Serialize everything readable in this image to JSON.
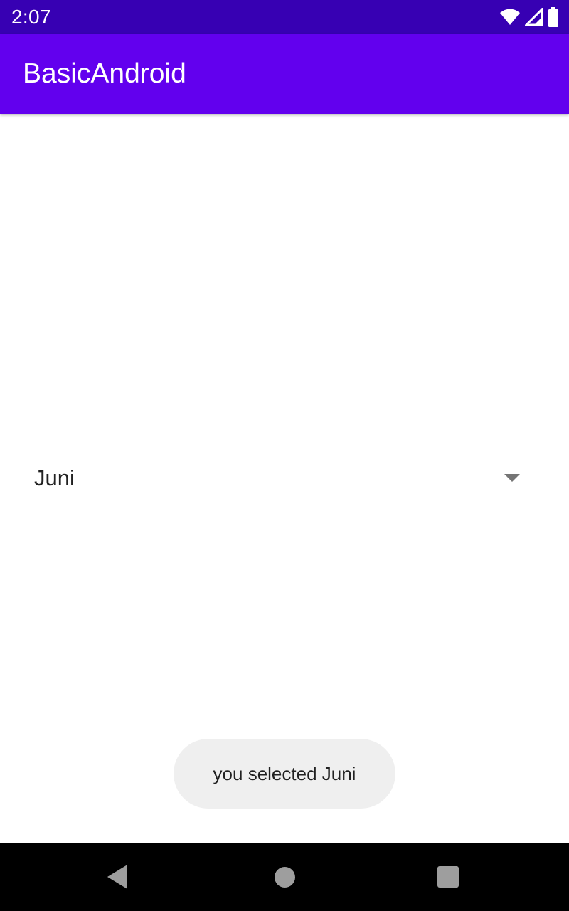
{
  "status_bar": {
    "time": "2:07",
    "icons": [
      "wifi-icon",
      "cellular-signal-icon",
      "battery-icon"
    ],
    "color": "#3700B3"
  },
  "app_bar": {
    "title": "BasicAndroid",
    "color": "#6200EE"
  },
  "spinner": {
    "selected": "Juni",
    "arrow_icon": "dropdown-arrow-icon"
  },
  "toast": {
    "message": "you selected Juni"
  },
  "nav_bar": {
    "buttons": [
      "back-button",
      "home-button",
      "recents-button"
    ]
  }
}
